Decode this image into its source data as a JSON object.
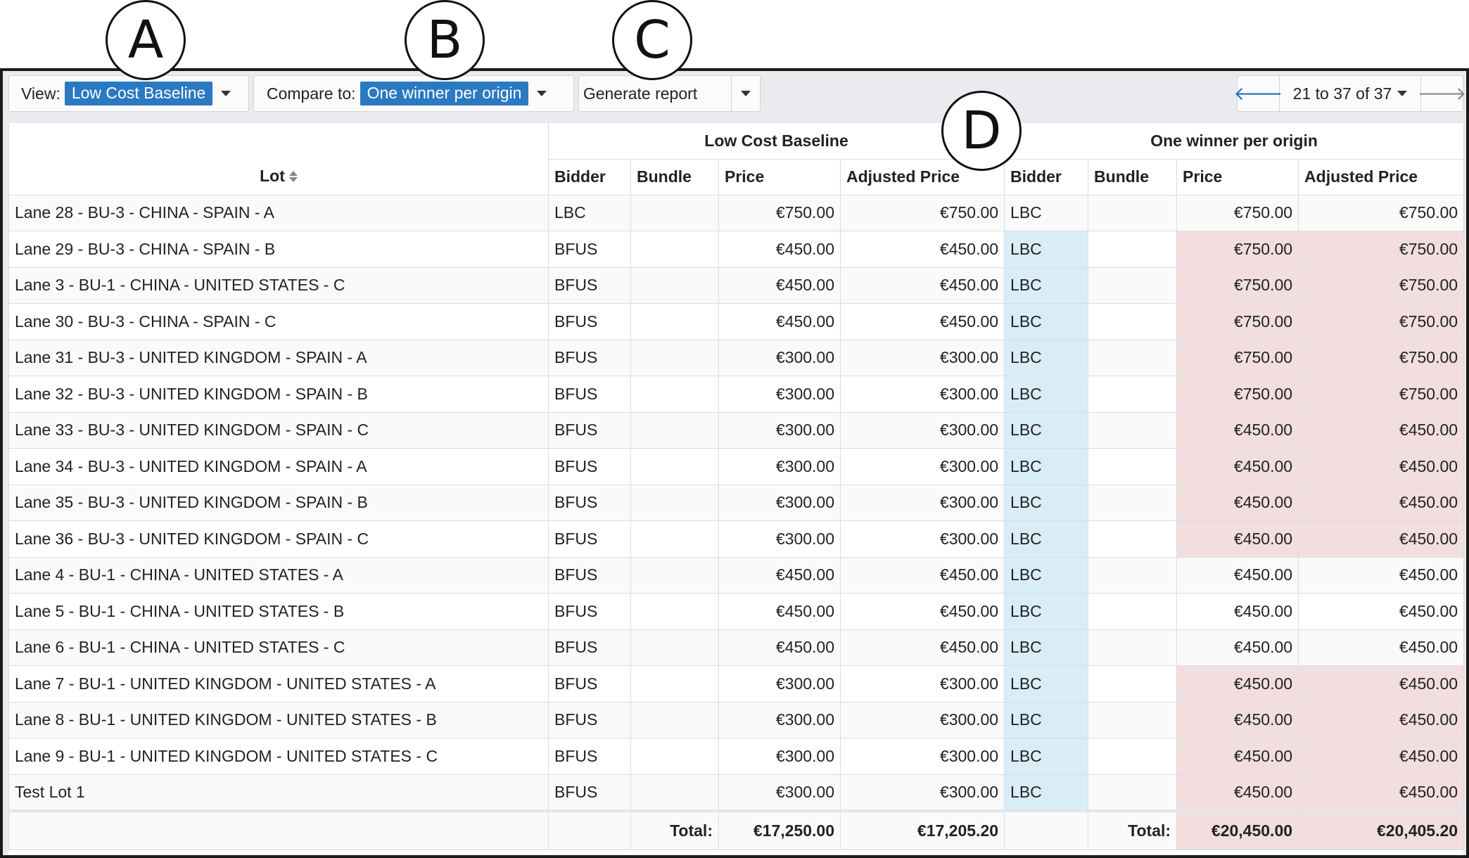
{
  "callouts": [
    "A",
    "B",
    "C",
    "D"
  ],
  "toolbar": {
    "view_label": "View:",
    "view_value": "Low Cost Baseline",
    "compare_label": "Compare to:",
    "compare_value": "One winner per origin",
    "generate_label": "Generate report",
    "pager_range": "21 to 37 of 37",
    "prev_icon": "arrow-left-icon",
    "next_icon": "arrow-right-icon"
  },
  "colors": {
    "accent": "#2a79c1",
    "highlight_blue": "#d9edf7",
    "highlight_red": "#f2dede"
  },
  "table": {
    "group_headers": {
      "left": "Low Cost Baseline",
      "right": "One winner per origin"
    },
    "lot_header": "Lot",
    "columns": [
      "Bidder",
      "Bundle",
      "Price",
      "Adjusted Price",
      "Bidder",
      "Bundle",
      "Price",
      "Adjusted Price"
    ],
    "rows": [
      {
        "lot": "Lane 28 - BU-3 - CHINA - SPAIN - A",
        "b1": "LBC",
        "p1": "€750.00",
        "a1": "€750.00",
        "b2": "LBC",
        "p2": "€750.00",
        "a2": "€750.00"
      },
      {
        "lot": "Lane 29 - BU-3 - CHINA - SPAIN - B",
        "b1": "BFUS",
        "p1": "€450.00",
        "a1": "€450.00",
        "b2": "LBC",
        "p2": "€750.00",
        "a2": "€750.00"
      },
      {
        "lot": "Lane 3 - BU-1 - CHINA - UNITED STATES - C",
        "b1": "BFUS",
        "p1": "€450.00",
        "a1": "€450.00",
        "b2": "LBC",
        "p2": "€750.00",
        "a2": "€750.00"
      },
      {
        "lot": "Lane 30 - BU-3 - CHINA - SPAIN - C",
        "b1": "BFUS",
        "p1": "€450.00",
        "a1": "€450.00",
        "b2": "LBC",
        "p2": "€750.00",
        "a2": "€750.00"
      },
      {
        "lot": "Lane 31 - BU-3 - UNITED KINGDOM - SPAIN - A",
        "b1": "BFUS",
        "p1": "€300.00",
        "a1": "€300.00",
        "b2": "LBC",
        "p2": "€750.00",
        "a2": "€750.00"
      },
      {
        "lot": "Lane 32 - BU-3 - UNITED KINGDOM - SPAIN - B",
        "b1": "BFUS",
        "p1": "€300.00",
        "a1": "€300.00",
        "b2": "LBC",
        "p2": "€750.00",
        "a2": "€750.00"
      },
      {
        "lot": "Lane 33 - BU-3 - UNITED KINGDOM - SPAIN - C",
        "b1": "BFUS",
        "p1": "€300.00",
        "a1": "€300.00",
        "b2": "LBC",
        "p2": "€450.00",
        "a2": "€450.00"
      },
      {
        "lot": "Lane 34 - BU-3 - UNITED KINGDOM - SPAIN - A",
        "b1": "BFUS",
        "p1": "€300.00",
        "a1": "€300.00",
        "b2": "LBC",
        "p2": "€450.00",
        "a2": "€450.00"
      },
      {
        "lot": "Lane 35 - BU-3 - UNITED KINGDOM - SPAIN - B",
        "b1": "BFUS",
        "p1": "€300.00",
        "a1": "€300.00",
        "b2": "LBC",
        "p2": "€450.00",
        "a2": "€450.00"
      },
      {
        "lot": "Lane 36 - BU-3 - UNITED KINGDOM - SPAIN - C",
        "b1": "BFUS",
        "p1": "€300.00",
        "a1": "€300.00",
        "b2": "LBC",
        "p2": "€450.00",
        "a2": "€450.00"
      },
      {
        "lot": "Lane 4 - BU-1 - CHINA - UNITED STATES - A",
        "b1": "BFUS",
        "p1": "€450.00",
        "a1": "€450.00",
        "b2": "LBC",
        "p2": "€450.00",
        "a2": "€450.00"
      },
      {
        "lot": "Lane 5 - BU-1 - CHINA - UNITED STATES - B",
        "b1": "BFUS",
        "p1": "€450.00",
        "a1": "€450.00",
        "b2": "LBC",
        "p2": "€450.00",
        "a2": "€450.00"
      },
      {
        "lot": "Lane 6 - BU-1 - CHINA - UNITED STATES - C",
        "b1": "BFUS",
        "p1": "€450.00",
        "a1": "€450.00",
        "b2": "LBC",
        "p2": "€450.00",
        "a2": "€450.00"
      },
      {
        "lot": "Lane 7 - BU-1 - UNITED KINGDOM - UNITED STATES - A",
        "b1": "BFUS",
        "p1": "€300.00",
        "a1": "€300.00",
        "b2": "LBC",
        "p2": "€450.00",
        "a2": "€450.00"
      },
      {
        "lot": "Lane 8 - BU-1 - UNITED KINGDOM - UNITED STATES - B",
        "b1": "BFUS",
        "p1": "€300.00",
        "a1": "€300.00",
        "b2": "LBC",
        "p2": "€450.00",
        "a2": "€450.00"
      },
      {
        "lot": "Lane 9 - BU-1 - UNITED KINGDOM - UNITED STATES - C",
        "b1": "BFUS",
        "p1": "€300.00",
        "a1": "€300.00",
        "b2": "LBC",
        "p2": "€450.00",
        "a2": "€450.00"
      },
      {
        "lot": "Test Lot 1",
        "b1": "BFUS",
        "p1": "€300.00",
        "a1": "€300.00",
        "b2": "LBC",
        "p2": "€450.00",
        "a2": "€450.00"
      }
    ],
    "totals": {
      "label": "Total:",
      "lcb_price": "€17,250.00",
      "lcb_adjusted": "€17,205.20",
      "owpo_price": "€20,450.00",
      "owpo_adjusted": "€20,405.20"
    }
  }
}
